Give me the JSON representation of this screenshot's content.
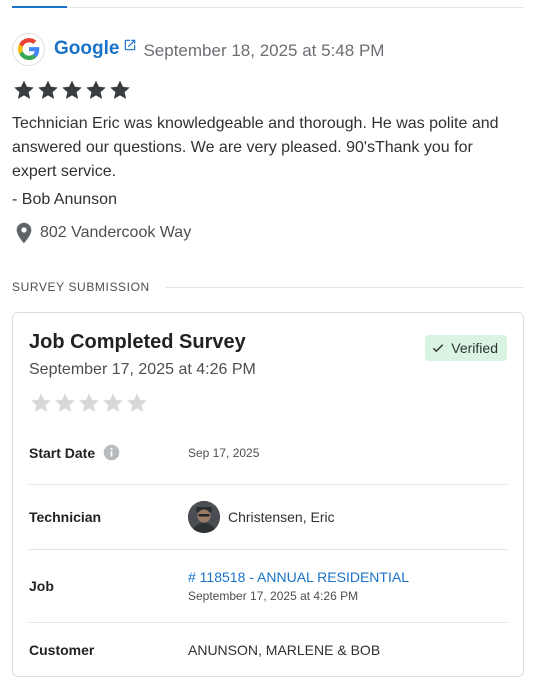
{
  "review": {
    "source": "Google",
    "date": "September 18, 2025 at 5:48 PM",
    "rating": 5,
    "text": "Technician Eric was knowledgeable and thorough. He was polite and answered our questions. We are very pleased. 90'sThank you for expert service.",
    "reviewer": "- Bob Anunson",
    "location": "802 Vandercook Way"
  },
  "section": {
    "label": "SURVEY SUBMISSION"
  },
  "survey": {
    "title": "Job Completed Survey",
    "date": "September 17, 2025 at 4:26 PM",
    "badge": "Verified",
    "rating": 0,
    "rows": {
      "start_date_label": "Start Date",
      "start_date_value": "Sep 17, 2025",
      "technician_label": "Technician",
      "technician_value": "Christensen, Eric",
      "job_label": "Job",
      "job_link": "# 118518 - ANNUAL RESIDENTIAL",
      "job_date": "September 17, 2025 at 4:26 PM",
      "customer_label": "Customer",
      "customer_value": "ANUNSON, MARLENE & BOB"
    }
  },
  "colors": {
    "link": "#1a73c8",
    "star_filled": "#3a3d40",
    "star_empty": "#d6d8da",
    "badge_bg": "#d9f5e2"
  },
  "icons": {
    "source_logo": "google-logo-icon",
    "external_link": "external-link-icon",
    "location": "map-pin-icon",
    "verified": "checkmark-icon",
    "info": "info-icon"
  }
}
